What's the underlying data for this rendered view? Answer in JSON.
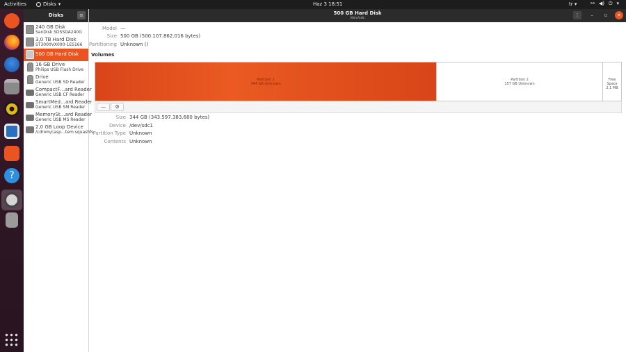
{
  "topbar": {
    "activities": "Activities",
    "app": "Disks",
    "clock": "Haz 3  18:51",
    "keyboard": "tr"
  },
  "sidebar": {
    "title": "Disks",
    "devices": [
      {
        "name": "240 GB Disk",
        "model": "SanDisk SDSSDA240G"
      },
      {
        "name": "3,0 TB Hard Disk",
        "model": "ST3000VX000-1ES166"
      },
      {
        "name": "500 GB Hard Disk",
        "model": ""
      },
      {
        "name": "16 GB Drive",
        "model": "Philips USB Flash Drive"
      },
      {
        "name": "Drive",
        "model": "Generic USB SD Reader"
      },
      {
        "name": "CompactF…ard Reader",
        "model": "Generic USB CF Reader"
      },
      {
        "name": "SmartMed…ard Reader",
        "model": "Generic USB SM Reader"
      },
      {
        "name": "MemorySt…ard Reader",
        "model": "Generic USB MS Reader"
      },
      {
        "name": "2,0 GB Loop Device",
        "model": "/cdrom/casp…tem.squashfs"
      }
    ]
  },
  "header": {
    "title": "500 GB Hard Disk",
    "subtitle": "/dev/sdc"
  },
  "disk": {
    "model_label": "Model",
    "model": "—",
    "size_label": "Size",
    "size": "500 GB (500.107.862.016 bytes)",
    "partitioning_label": "Partitioning",
    "partitioning": "Unknown ()"
  },
  "volumes": {
    "title": "Volumes",
    "partitions": [
      {
        "name": "Partition 1",
        "desc": "344 GB Unknown"
      },
      {
        "name": "Partition 2",
        "desc": "157 GB Unknown"
      },
      {
        "name": "Free Space",
        "desc": "2,1 MB"
      }
    ],
    "remove_button": "—"
  },
  "selected": {
    "size_label": "Size",
    "size": "344 GB (343.597.383.680 bytes)",
    "device_label": "Device",
    "device": "/dev/sdc1",
    "ptype_label": "Partition Type",
    "ptype": "Unknown",
    "contents_label": "Contents",
    "contents": "Unknown"
  },
  "colors": {
    "accent": "#e95420",
    "header": "#2b2b2b"
  },
  "icons": {
    "dock": [
      "ubuntu-logo-icon",
      "firefox-icon",
      "thunderbird-icon",
      "files-icon",
      "rhythmbox-icon",
      "writer-icon",
      "software-center-icon",
      "help-icon",
      "disks-app-icon",
      "drive-icon",
      "show-apps-icon"
    ]
  }
}
